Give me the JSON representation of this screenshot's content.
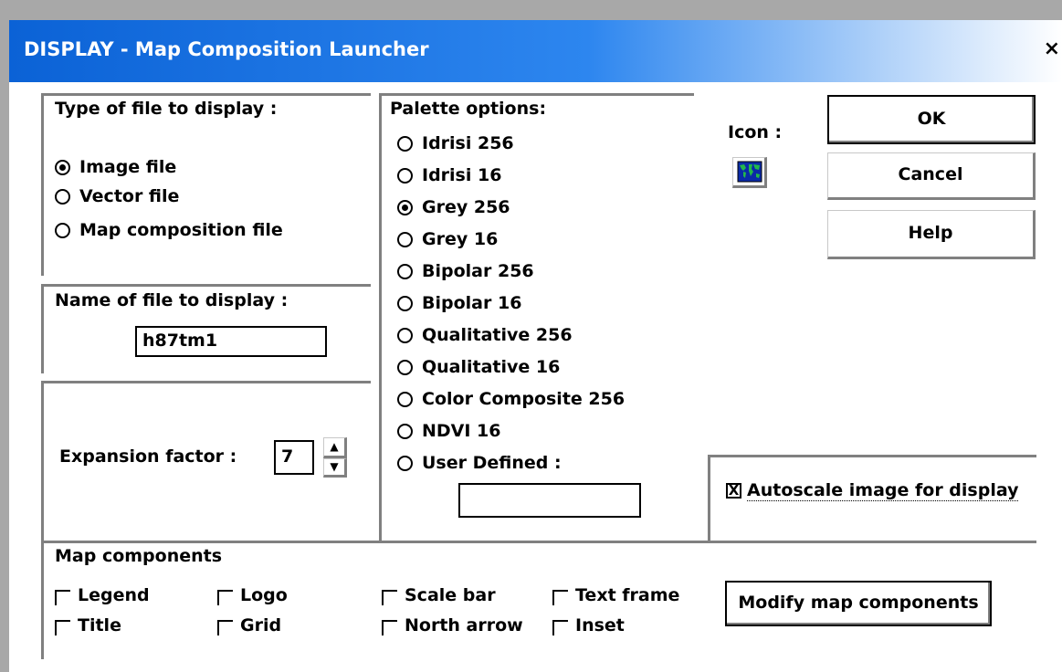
{
  "window": {
    "title": "DISPLAY - Map Composition Launcher",
    "close_glyph": "×"
  },
  "type_group": {
    "label": "Type of file to display :",
    "options": [
      {
        "label": "Image file",
        "selected": true
      },
      {
        "label": "Vector file",
        "selected": false
      },
      {
        "label": "Map composition file",
        "selected": false
      }
    ]
  },
  "name_group": {
    "label": "Name of file to display :",
    "value": "h87tm1"
  },
  "expansion": {
    "label": "Expansion factor :",
    "value": "7",
    "up_glyph": "▲",
    "down_glyph": "▼"
  },
  "palette": {
    "label": "Palette options:",
    "options": [
      {
        "label": "Idrisi 256",
        "selected": false
      },
      {
        "label": "Idrisi 16",
        "selected": false
      },
      {
        "label": "Grey 256",
        "selected": true
      },
      {
        "label": "Grey 16",
        "selected": false
      },
      {
        "label": "Bipolar 256",
        "selected": false
      },
      {
        "label": "Bipolar 16",
        "selected": false
      },
      {
        "label": "Qualitative 256",
        "selected": false
      },
      {
        "label": "Qualitative 16",
        "selected": false
      },
      {
        "label": "Color Composite 256",
        "selected": false
      },
      {
        "label": "NDVI 16",
        "selected": false
      },
      {
        "label": "User Defined :",
        "selected": false
      }
    ],
    "user_defined_value": ""
  },
  "icon": {
    "label": "Icon :",
    "icon_name": "world-map-icon"
  },
  "buttons": {
    "ok": "OK",
    "cancel": "Cancel",
    "help": "Help",
    "modify": "Modify map components"
  },
  "autoscale": {
    "label": "Autoscale image for display",
    "checked": true,
    "mark": "X"
  },
  "map_components": {
    "label": "Map components",
    "items": {
      "legend": "Legend",
      "logo": "Logo",
      "scale_bar": "Scale bar",
      "text_frame": "Text frame",
      "title": "Title",
      "grid": "Grid",
      "north_arrow": "North arrow",
      "inset": "Inset"
    }
  },
  "colors": {
    "titlebar_start": "#0b62d6",
    "titlebar_end": "#ffffff",
    "frame": "#a8a8a8",
    "group_border": "#808080"
  }
}
